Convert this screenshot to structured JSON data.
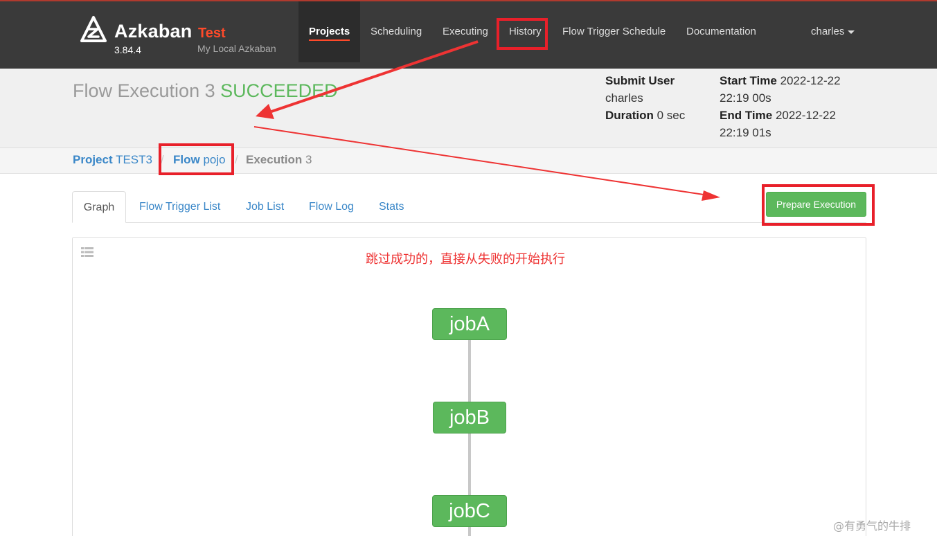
{
  "brand": {
    "name": "Azkaban",
    "env": "Test",
    "version": "3.84.4",
    "subtitle": "My Local Azkaban"
  },
  "nav": {
    "items": [
      {
        "label": "Projects",
        "active": true
      },
      {
        "label": "Scheduling"
      },
      {
        "label": "Executing"
      },
      {
        "label": "History"
      },
      {
        "label": "Flow Trigger Schedule"
      },
      {
        "label": "Documentation"
      }
    ],
    "user": "charles"
  },
  "execution": {
    "title": "Flow Execution 3",
    "status": "SUCCEEDED",
    "submit_user_label": "Submit User",
    "submit_user": "charles",
    "duration_label": "Duration",
    "duration": "0 sec",
    "start_time_label": "Start Time",
    "start_time_date": "2022-12-22",
    "start_time_time": "22:19 00s",
    "end_time_label": "End Time",
    "end_time_date": "2022-12-22",
    "end_time_time": "22:19 01s"
  },
  "breadcrumb": {
    "project_key": "Project",
    "project_value": "TEST3",
    "flow_key": "Flow",
    "flow_value": "pojo",
    "execution_key": "Execution",
    "execution_value": "3",
    "separator": "/"
  },
  "tabs": [
    "Graph",
    "Flow Trigger List",
    "Job List",
    "Flow Log",
    "Stats"
  ],
  "prepare_button": "Prepare Execution",
  "annotation": "跳过成功的，直接从失败的开始执行",
  "jobs": [
    "jobA",
    "jobB",
    "jobC"
  ],
  "watermark": "@有勇气的牛排",
  "colors": {
    "navbar": "#3a3a3a",
    "brand_env": "#ff4a2a",
    "success": "#5cb85c",
    "link": "#3a87c8",
    "annotation": "#e8202a"
  }
}
